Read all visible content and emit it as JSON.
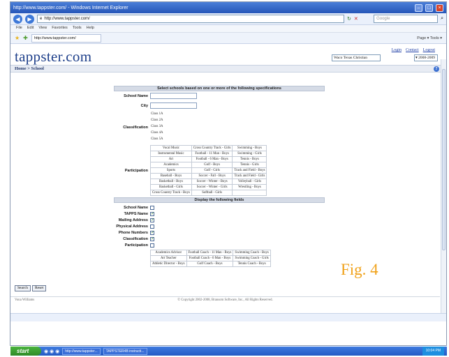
{
  "window": {
    "title": "http://www.tappster.com/ - Windows Internet Explorer",
    "address": "http://www.tappster.com/",
    "search_placeholder": "Google",
    "menu": [
      "File",
      "Edit",
      "View",
      "Favorites",
      "Tools",
      "Help"
    ],
    "fav_tab": "http://www.tappster.com/",
    "toolbar_text": "Page ▾  Tools ▾"
  },
  "site": {
    "logo": "tappster.com",
    "links": [
      "Login",
      "Contact",
      "Logout"
    ],
    "school_select": "Waco Texas Christian",
    "year_select": "2008-2009",
    "breadcrumb": "Home > School"
  },
  "form": {
    "select_heading": "Select schools based on one or more of the following specifications",
    "school_name_label": "School Name",
    "city_label": "City",
    "classification_label": "Classification",
    "classes": [
      "Class 1A",
      "Class 2A",
      "Class 3A",
      "Class 4A",
      "Class 5A"
    ],
    "participation_label": "Participation",
    "participation": [
      [
        "Vocal Music",
        "Cross Country Track - Girls",
        "Swimming - Boys"
      ],
      [
        "Instrumental Music",
        "Football - 11 Man - Boys",
        "Swimming - Girls"
      ],
      [
        "Art",
        "Football - 6 Man - Boys",
        "Tennis - Boys"
      ],
      [
        "Academics",
        "Golf - Boys",
        "Tennis - Girls"
      ],
      [
        "Sports",
        "Golf - Girls",
        "Track and Field - Boys"
      ],
      [
        "Baseball - Boys",
        "Soccer - Fall - Boys",
        "Track and Field - Girls"
      ],
      [
        "Basketball - Boys",
        "Soccer - Winter - Boys",
        "Volleyball - Girls"
      ],
      [
        "Basketball - Girls",
        "Soccer - Winter - Girls",
        "Wrestling - Boys"
      ],
      [
        "Cross Country Track - Boys",
        "Softball - Girls",
        ""
      ]
    ],
    "display_heading": "Display the following fields",
    "display_fields": [
      {
        "label": "School Name",
        "checked": false
      },
      {
        "label": "TAPPS Name",
        "checked": true
      },
      {
        "label": "Mailing Address",
        "checked": true
      },
      {
        "label": "Physical Address",
        "checked": false
      },
      {
        "label": "Phone Numbers",
        "checked": true
      },
      {
        "label": "Classification",
        "checked": true
      },
      {
        "label": "Participation",
        "checked": false
      }
    ],
    "staff": [
      [
        "Academics Advisor",
        "Football Coach - 11 Man - Boys",
        "Swimming Coach - Boys"
      ],
      [
        "Art Teacher",
        "Football Coach - 6 Man - Boys",
        "Swimming Coach - Girls"
      ],
      [
        "Athletic Director - Boys",
        "Golf Coach - Boys",
        "Tennis Coach - Boys"
      ]
    ],
    "search_button": "Search",
    "reset_button": "Reset"
  },
  "footer": {
    "left": "Vona Williams",
    "copyright": "© Copyright 2002-2008, Bransom Software, Inc., All Rights Reserved."
  },
  "figure_label": "Fig. 4",
  "taskbar": {
    "start": "start",
    "items": [
      "http://www.tappster...",
      "TAPPSTER4B instructi..."
    ],
    "clock": "10:04 PM"
  }
}
